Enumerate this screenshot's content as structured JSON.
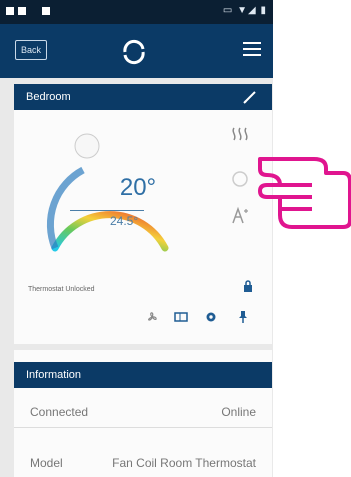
{
  "appbar": {
    "back_label": "Back"
  },
  "room": {
    "title": "Bedroom"
  },
  "thermostat": {
    "setpoint": "20°",
    "current": "24.5°",
    "status": "Thermostat Unlocked",
    "dial_colors": [
      "#22c9e8",
      "#68c95b",
      "#f4d13b",
      "#f08b32",
      "#e44b2f"
    ],
    "side_icons": [
      "heating-icon",
      "schedule-icon",
      "auto-mode-icon"
    ],
    "bottom_icons": [
      "fan-icon",
      "display-icon",
      "settings-icon",
      "pin-icon"
    ]
  },
  "information": {
    "title": "Information",
    "rows": [
      {
        "key": "Connected",
        "value": "Online"
      },
      {
        "key": "Model",
        "value": "Fan Coil Room Thermostat"
      }
    ]
  },
  "accent": {
    "pointer_hand": "#e0158f",
    "header": "#0b3a66"
  }
}
